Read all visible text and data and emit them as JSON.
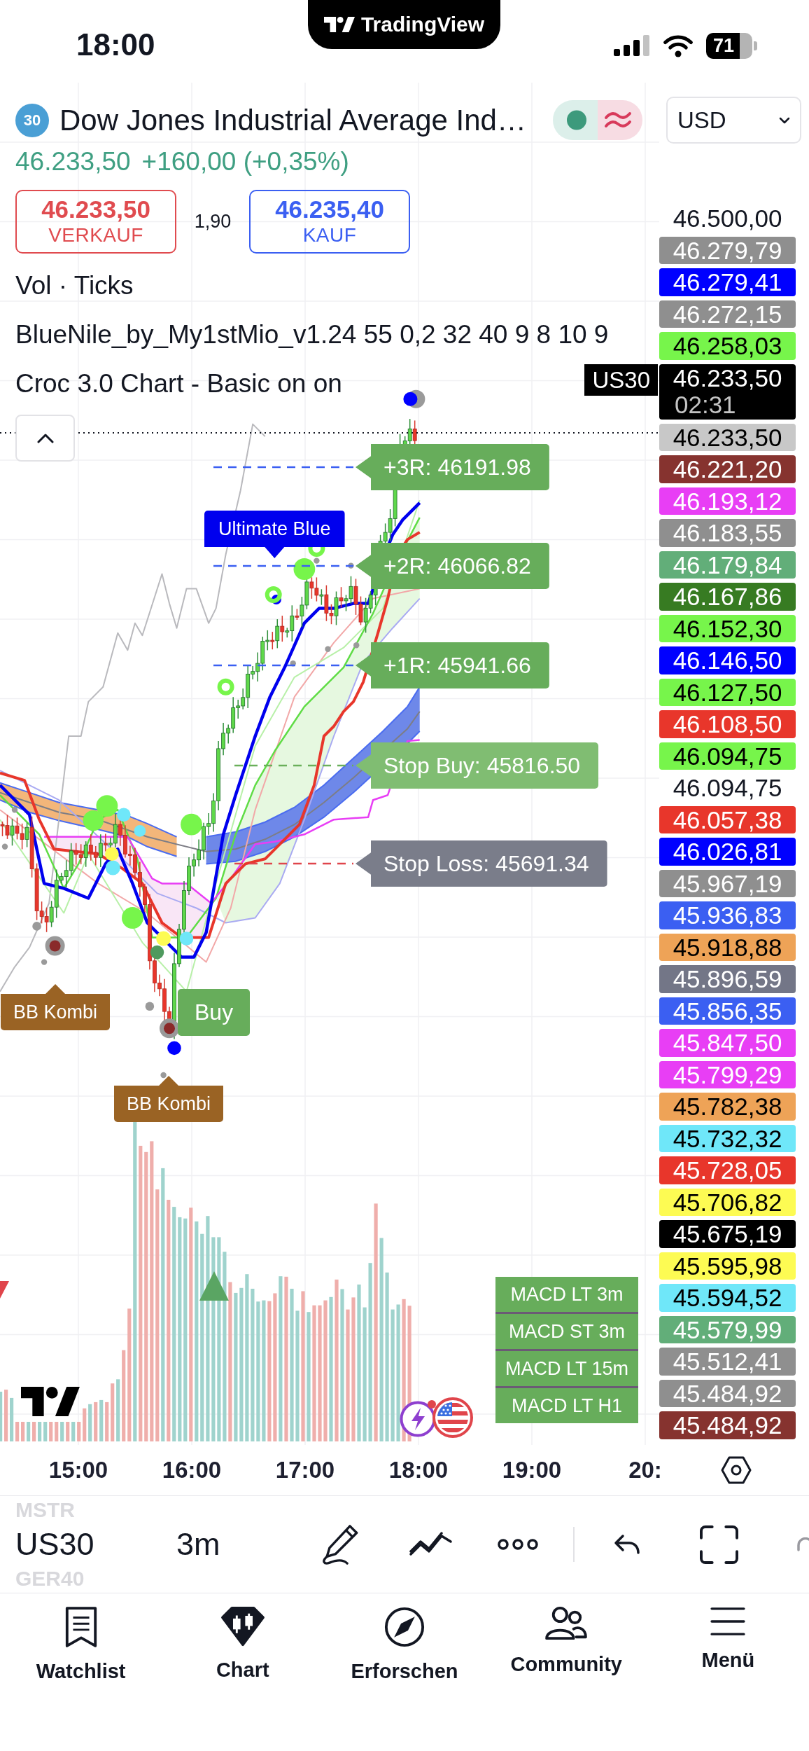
{
  "status_bar": {
    "time": "18:00",
    "app_name": "TradingView",
    "battery": "71"
  },
  "header": {
    "badge": "30",
    "title": "Dow Jones Industrial Average Ind…",
    "currency": "USD"
  },
  "quote": {
    "last": "46.233,50",
    "change": "+160,00 (+0,35%)"
  },
  "trade": {
    "sell": {
      "price": "46.233,50",
      "label": "VERKAUF"
    },
    "spread": "1,90",
    "buy": {
      "price": "46.235,40",
      "label": "KAUF"
    }
  },
  "legend": [
    "Vol · Ticks",
    "BlueNile_by_My1stMio_v1.24 55 0,2 32 40 9 8 10 9",
    "Croc 3.0 Chart - Basic on on"
  ],
  "chart": {
    "levels": [
      {
        "kind": "target",
        "text": "+3R: 46191.98",
        "color": "#67ad5b"
      },
      {
        "kind": "target",
        "text": "+2R: 46066.82",
        "color": "#67ad5b"
      },
      {
        "kind": "target",
        "text": "+1R: 45941.66",
        "color": "#67ad5b"
      },
      {
        "kind": "stop_buy",
        "text": "Stop Buy: 45816.50",
        "color": "#80bd72"
      },
      {
        "kind": "stop_loss",
        "text": "Stop Loss: 45691.34",
        "color": "#7a7d8a"
      }
    ],
    "signals": [
      {
        "kind": "callout_down",
        "text": "Ultimate Blue",
        "color": "#0000ee"
      },
      {
        "kind": "flag",
        "text": "Buy",
        "color": "#67ad5b"
      },
      {
        "kind": "callout_up",
        "text": "BB Kombi",
        "color": "#9a6324"
      },
      {
        "kind": "callout_up",
        "text": "BB Kombi",
        "color": "#9a6324"
      }
    ],
    "macd_panel": [
      "MACD LT 3m",
      "MACD ST 3m",
      "MACD LT 15m",
      "MACD LT H1"
    ]
  },
  "price_axis": {
    "symbol_tag": "US30",
    "labels": [
      {
        "kind": "tick",
        "text": "46.500,00"
      },
      {
        "kind": "label",
        "text": "46.279,79",
        "color": "#8f8f8f"
      },
      {
        "kind": "label",
        "text": "46.279,41",
        "color": "#0000ff"
      },
      {
        "kind": "label",
        "text": "46.272,15",
        "color": "#8f8f8f"
      },
      {
        "kind": "label",
        "text": "46.258,03",
        "color": "#77f54b"
      },
      {
        "kind": "current",
        "text": "46.233,50",
        "countdown": "02:31",
        "color": "#000000"
      },
      {
        "kind": "label",
        "text": "46.233,50",
        "color": "#c8c8c8"
      },
      {
        "kind": "label",
        "text": "46.221,20",
        "color": "#86332f"
      },
      {
        "kind": "label",
        "text": "46.193,12",
        "color": "#e83ef5"
      },
      {
        "kind": "label",
        "text": "46.183,55",
        "color": "#8f8f8f"
      },
      {
        "kind": "label",
        "text": "46.179,84",
        "color": "#62ae79"
      },
      {
        "kind": "label",
        "text": "46.167,86",
        "color": "#377b22"
      },
      {
        "kind": "label",
        "text": "46.152,30",
        "color": "#77f54b"
      },
      {
        "kind": "label",
        "text": "46.146,50",
        "color": "#0000ff"
      },
      {
        "kind": "label",
        "text": "46.127,50",
        "color": "#77f54b"
      },
      {
        "kind": "label",
        "text": "46.108,50",
        "color": "#e8362b"
      },
      {
        "kind": "label",
        "text": "46.094,75",
        "color": "#77f54b"
      },
      {
        "kind": "tick",
        "text": "46.094,75"
      },
      {
        "kind": "label",
        "text": "46.057,38",
        "color": "#e8362b"
      },
      {
        "kind": "label",
        "text": "46.026,81",
        "color": "#0000ff"
      },
      {
        "kind": "label",
        "text": "45.967,19",
        "color": "#8f8f8f"
      },
      {
        "kind": "label",
        "text": "45.936,83",
        "color": "#3b5ff2"
      },
      {
        "kind": "label",
        "text": "45.918,88",
        "color": "#eea357"
      },
      {
        "kind": "label",
        "text": "45.896,59",
        "color": "#737687"
      },
      {
        "kind": "label",
        "text": "45.856,35",
        "color": "#3b5ff2"
      },
      {
        "kind": "label",
        "text": "45.847,50",
        "color": "#e83ef5"
      },
      {
        "kind": "label",
        "text": "45.799,29",
        "color": "#e83ef5"
      },
      {
        "kind": "label",
        "text": "45.782,38",
        "color": "#eea357"
      },
      {
        "kind": "label",
        "text": "45.732,32",
        "color": "#6fe7f9"
      },
      {
        "kind": "label",
        "text": "45.728,05",
        "color": "#e8362b"
      },
      {
        "kind": "label",
        "text": "45.706,82",
        "color": "#fdfb53"
      },
      {
        "kind": "label",
        "text": "45.675,19",
        "color": "#000000"
      },
      {
        "kind": "label",
        "text": "45.595,98",
        "color": "#fdfb53"
      },
      {
        "kind": "label",
        "text": "45.594,52",
        "color": "#6fe7f9"
      },
      {
        "kind": "label",
        "text": "45.579,99",
        "color": "#62ae79"
      },
      {
        "kind": "label",
        "text": "45.512,41",
        "color": "#8f8f8f"
      },
      {
        "kind": "label",
        "text": "45.484,92",
        "color": "#8f8f8f"
      },
      {
        "kind": "label",
        "text": "45.484,92",
        "color": "#86332f"
      }
    ]
  },
  "time_axis": [
    "15:00",
    "16:00",
    "17:00",
    "18:00",
    "19:00",
    "20:"
  ],
  "toolbar": {
    "symbols": [
      {
        "label": "MSTR",
        "selected": false
      },
      {
        "label": "US30",
        "selected": true
      },
      {
        "label": "GER40",
        "selected": false
      }
    ],
    "interval": "3m"
  },
  "tab_bar": [
    {
      "label": "Watchlist",
      "selected": false
    },
    {
      "label": "Chart",
      "selected": true
    },
    {
      "label": "Erforschen",
      "selected": false
    },
    {
      "label": "Community",
      "selected": false
    },
    {
      "label": "Menü",
      "selected": false
    }
  ]
}
